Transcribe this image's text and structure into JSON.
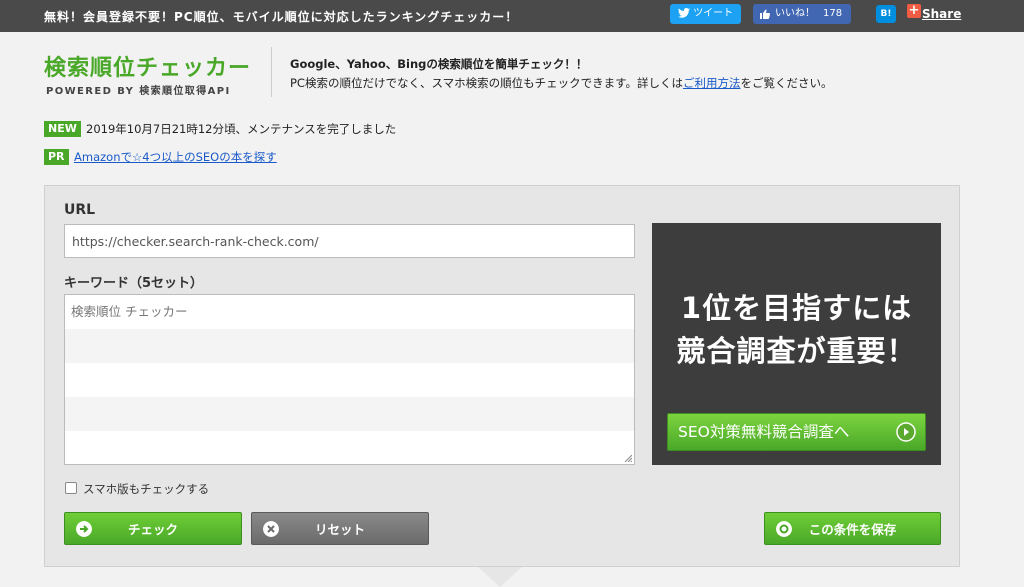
{
  "topbar": {
    "tagline": "無料！会員登録不要！PC順位、モバイル順位に対応したランキングチェッカー！",
    "tweet_label": "ツイート",
    "like_label": "いいね！",
    "like_count": "178",
    "hatena_label": "B!",
    "share_label": "Share"
  },
  "header": {
    "title": "検索順位チェッカー",
    "subtitle": "POWERED BY 検索順位取得API",
    "desc_line1": "Google、Yahoo、Bingの検索順位を簡単チェック！！",
    "desc_line2_pre": "PC検索の順位だけでなく、スマホ検索の順位もチェックできます。詳しくは",
    "desc_line2_link": "ご利用方法",
    "desc_line2_post": "をご覧ください。"
  },
  "news": {
    "new_badge": "NEW",
    "new_text": "2019年10月7日21時12分頃、メンテナンスを完了しました",
    "pr_badge": "PR",
    "pr_text": "Amazonで☆4つ以上のSEOの本を探す"
  },
  "form": {
    "url_label": "URL",
    "url_value": "https://checker.search-rank-check.com/",
    "keyword_label": "キーワード（5セット）",
    "keyword_placeholder": "検索順位 チェッカー",
    "mobile_check_label": "スマホ版もチェックする",
    "check_button": "チェック",
    "reset_button": "リセット",
    "save_button": "この条件を保存"
  },
  "ad": {
    "line1": "1位を目指すには",
    "line2": "競合調査が重要！",
    "button": "SEO対策無料競合調査へ"
  },
  "colors": {
    "brand_green": "#4aa829",
    "topbar": "#4a4a4a",
    "twitter": "#1da1f2",
    "facebook": "#4267b2",
    "link": "#1a5ac8"
  }
}
